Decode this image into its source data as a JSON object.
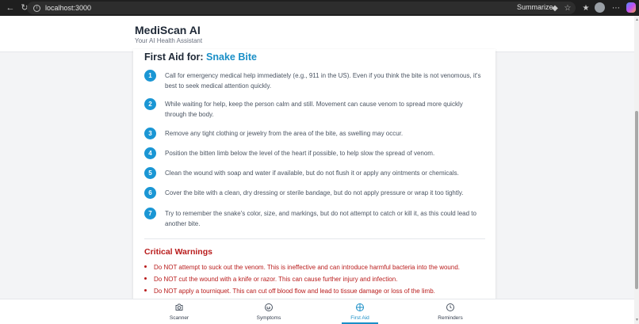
{
  "browser": {
    "url": "localhost:3000",
    "summarize_label": "Summarize"
  },
  "app": {
    "title": "MediScan AI",
    "subtitle": "Your AI Health Assistant"
  },
  "first_aid": {
    "title_prefix": "First Aid for:",
    "condition": "Snake Bite",
    "steps": [
      {
        "num": "1",
        "text": "Call for emergency medical help immediately (e.g., 911 in the US). Even if you think the bite is not venomous, it's best to seek medical attention quickly."
      },
      {
        "num": "2",
        "text": "While waiting for help, keep the person calm and still. Movement can cause venom to spread more quickly through the body."
      },
      {
        "num": "3",
        "text": "Remove any tight clothing or jewelry from the area of the bite, as swelling may occur."
      },
      {
        "num": "4",
        "text": "Position the bitten limb below the level of the heart if possible, to help slow the spread of venom."
      },
      {
        "num": "5",
        "text": "Clean the wound with soap and water if available, but do not flush it or apply any ointments or chemicals."
      },
      {
        "num": "6",
        "text": "Cover the bite with a clean, dry dressing or sterile bandage, but do not apply pressure or wrap it too tightly."
      },
      {
        "num": "7",
        "text": "Try to remember the snake's color, size, and markings, but do not attempt to catch or kill it, as this could lead to another bite."
      }
    ],
    "warnings_title": "Critical Warnings",
    "warnings": [
      "Do NOT attempt to suck out the venom. This is ineffective and can introduce harmful bacteria into the wound.",
      "Do NOT cut the wound with a knife or razor. This can cause further injury and infection.",
      "Do NOT apply a tourniquet. This can cut off blood flow and lead to tissue damage or loss of the limb."
    ]
  },
  "bottom_nav": {
    "items": [
      {
        "label": "Scanner",
        "icon": "camera-icon"
      },
      {
        "label": "Symptoms",
        "icon": "stethoscope-icon"
      },
      {
        "label": "First Aid",
        "icon": "first-aid-icon",
        "active": true
      },
      {
        "label": "Reminders",
        "icon": "clock-icon"
      }
    ]
  },
  "colors": {
    "accent": "#1a8fc7",
    "step_badge": "#1a96d4",
    "warning": "#b91c1c"
  }
}
